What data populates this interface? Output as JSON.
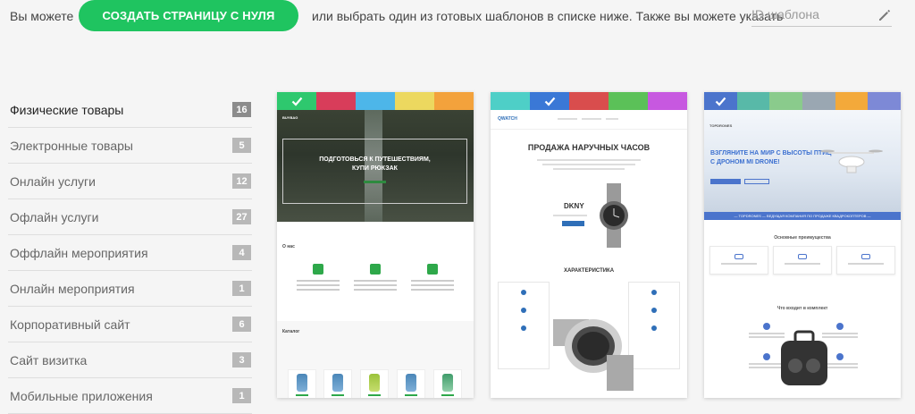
{
  "topbar": {
    "intro_text": "Вы можете",
    "create_button": "СОЗДАТЬ СТРАНИЦУ С НУЛЯ",
    "rest_text": "или выбрать один из готовых шаблонов в списке ниже. Также вы можете указать",
    "id_placeholder": "ID шаблона",
    "id_value": ""
  },
  "colors": {
    "accent_green": "#1fc460",
    "count_badge": "#b8b8b8",
    "count_badge_active": "#8c8c8c"
  },
  "categories": [
    {
      "label": "Физические товары",
      "count": "16",
      "active": true
    },
    {
      "label": "Электронные товары",
      "count": "5"
    },
    {
      "label": "Онлайн услуги",
      "count": "12"
    },
    {
      "label": "Офлайн услуги",
      "count": "27"
    },
    {
      "label": "Оффлайн мероприятия",
      "count": "4"
    },
    {
      "label": "Онлайн мероприятия",
      "count": "1"
    },
    {
      "label": "Корпоративный сайт",
      "count": "6"
    },
    {
      "label": "Сайт визитка",
      "count": "3"
    },
    {
      "label": "Мобильные приложения",
      "count": "1"
    }
  ],
  "templates": [
    {
      "swatches": [
        "#2ec86e",
        "#d83d5a",
        "#4db6e9",
        "#ecd85f",
        "#f3a23c"
      ],
      "selected_swatch": 0,
      "preview": {
        "nav_logo": "BUYBAG",
        "hero_title_line1": "ПОДГОТОВЬСЯ К ПУТЕШЕСТВИЯМ,",
        "hero_title_line2": "КУПИ РЮКЗАК",
        "about_label": "О нас",
        "catalog_label": "Каталог"
      }
    },
    {
      "swatches": [
        "#4ecfc7",
        "#3a78d6",
        "#d94d4d",
        "#5bc158",
        "#c758e0"
      ],
      "selected_swatch": 1,
      "preview": {
        "logo": "QWATCH",
        "title": "ПРОДАЖА НАРУЧНЫХ ЧАСОВ",
        "brand": "DKNY",
        "section": "ХАРАКТЕРИСТИКА"
      }
    },
    {
      "swatches": [
        "#4b74cc",
        "#58b9a8",
        "#8acb8c",
        "#9aa7b2",
        "#f3a93a",
        "#7d89d6"
      ],
      "selected_swatch": 0,
      "preview": {
        "logo": "TOPDRONES",
        "hero_line1": "ВЗГЛЯНИТЕ НА МИР С ВЫСОТЫ ПТИЦ",
        "hero_line2": "С ДРОНОМ MI DRONE!",
        "bar_text": "— TOPDRONES — ВЕДУЩАЯ КОМПАНИЯ ПО ПРОДАЖЕ КВАДРОКОПТЕРОВ —",
        "advantages": "Основные преимущества",
        "kit": "Что входит в комплект"
      }
    }
  ]
}
